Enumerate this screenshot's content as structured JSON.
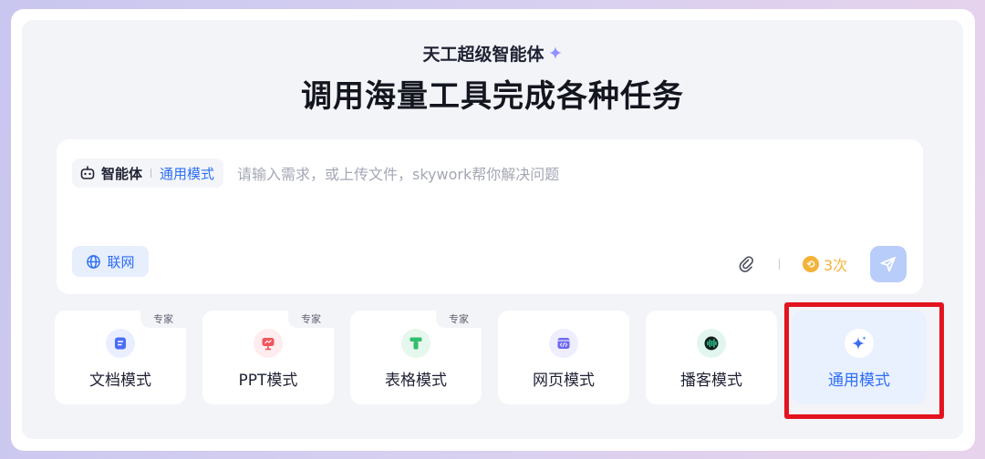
{
  "brand": {
    "title": "天工超级智能体",
    "icon": "sparkle-icon"
  },
  "headline": "调用海量工具完成各种任务",
  "input_card": {
    "agent_label": "智能体",
    "mode_label": "通用模式",
    "placeholder": "请输入需求，或上传文件，skywork帮你解决问题",
    "web_button": "联网",
    "credits": "3次",
    "coin_icon": "coin-icon",
    "attach_icon": "paperclip-icon",
    "send_icon": "send-icon"
  },
  "modes": [
    {
      "name": "文档模式",
      "badge": "专家",
      "icon": "document-icon",
      "color": "#4a6cf7",
      "bg": "#eaefff"
    },
    {
      "name": "PPT模式",
      "badge": "专家",
      "icon": "presentation-icon",
      "color": "#f2545b",
      "bg": "#ffecee"
    },
    {
      "name": "表格模式",
      "badge": "专家",
      "icon": "table-icon",
      "color": "#2fbf6b",
      "bg": "#e6f7ee"
    },
    {
      "name": "网页模式",
      "badge": "",
      "icon": "code-window-icon",
      "color": "#6e6af0",
      "bg": "#efeefe"
    },
    {
      "name": "播客模式",
      "badge": "",
      "icon": "audio-wave-icon",
      "color": "#10a37f",
      "bg": "#e2f6ef"
    },
    {
      "name": "通用模式",
      "badge": "",
      "icon": "sparkle-icon",
      "color": "#2d6ff5",
      "bg": "#ffffff",
      "selected": true
    }
  ],
  "colors": {
    "accent": "#2d6ff5",
    "highlight": "#e3131f",
    "credits": "#f3b33a"
  }
}
